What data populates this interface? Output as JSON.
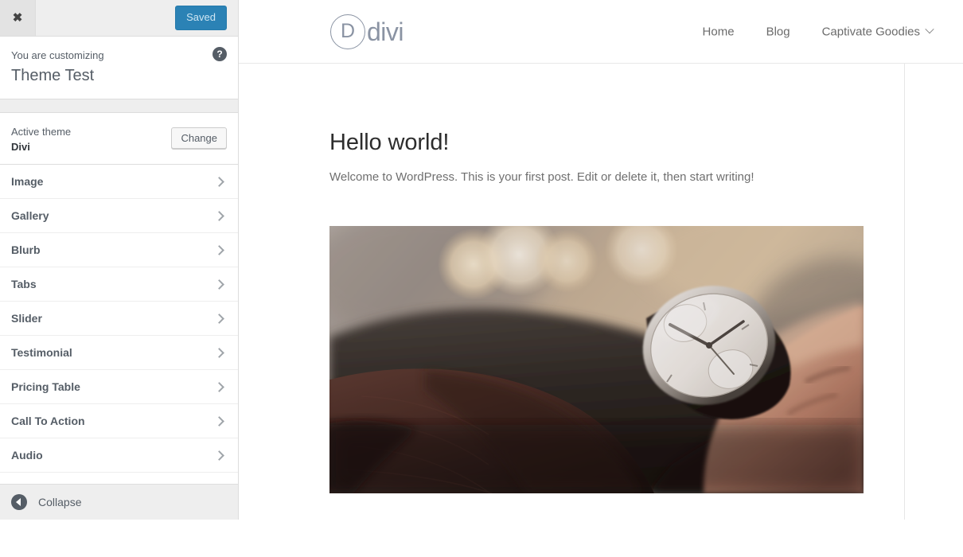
{
  "customizer": {
    "close_icon": "close-x-icon",
    "save_button": "Saved",
    "help_icon": "?",
    "kicker": "You are customizing",
    "site_name": "Theme Test",
    "active_theme_label": "Active theme",
    "active_theme_name": "Divi",
    "change_button": "Change",
    "sections": [
      {
        "label": "Image"
      },
      {
        "label": "Gallery"
      },
      {
        "label": "Blurb"
      },
      {
        "label": "Tabs"
      },
      {
        "label": "Slider"
      },
      {
        "label": "Testimonial"
      },
      {
        "label": "Pricing Table"
      },
      {
        "label": "Call To Action"
      },
      {
        "label": "Audio"
      }
    ],
    "collapse_label": "Collapse",
    "accent_blue": "#2b82b5",
    "panel_bg": "#eeeeee"
  },
  "preview": {
    "logo": {
      "mark": "D",
      "text": "divi"
    },
    "nav": [
      {
        "label": "Home",
        "has_dropdown": false
      },
      {
        "label": "Blog",
        "has_dropdown": false
      },
      {
        "label": "Captivate Goodies",
        "has_dropdown": true
      }
    ],
    "post": {
      "title": "Hello world!",
      "excerpt": "Welcome to WordPress. This is your first post. Edit or delete it, then start writing!",
      "photo_alt": "Close-up of a wrist wearing a chronograph watch, hand resting on a dark steering wheel with warm bokeh lights"
    }
  }
}
